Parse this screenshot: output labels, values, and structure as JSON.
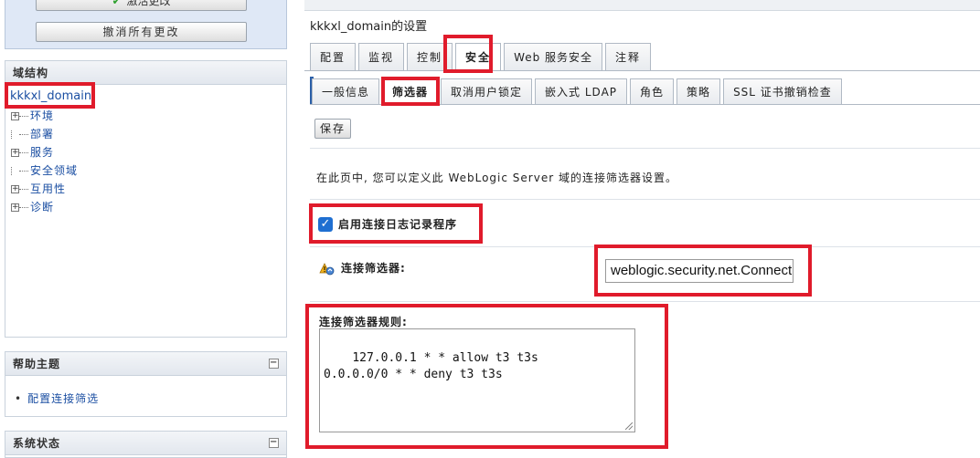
{
  "changes_panel": {
    "activate_label": "激活更改",
    "undo_label": "撤消所有更改"
  },
  "domain_panel": {
    "header": "域结构",
    "domain_name": "kkkxl_domain",
    "tree": [
      {
        "label": "环境",
        "expandable": true
      },
      {
        "label": "部署",
        "expandable": false
      },
      {
        "label": "服务",
        "expandable": true
      },
      {
        "label": "安全领域",
        "expandable": false
      },
      {
        "label": "互用性",
        "expandable": true
      },
      {
        "label": "诊断",
        "expandable": true
      }
    ]
  },
  "help_panel": {
    "header": "帮助主题",
    "items": [
      "配置连接筛选"
    ]
  },
  "status_panel": {
    "header": "系统状态"
  },
  "main": {
    "title_domain": "kkkxl_domain",
    "title_suffix": "的设置",
    "tabs": [
      "配置",
      "监视",
      "控制",
      "安全",
      "Web 服务安全",
      "注释"
    ],
    "active_tab": "安全",
    "subtabs": [
      "一般信息",
      "筛选器",
      "取消用户锁定",
      "嵌入式 LDAP",
      "角色",
      "策略",
      "SSL 证书撤销检查"
    ],
    "active_subtab": "筛选器",
    "save_label": "保存",
    "intro": "在此页中, 您可以定义此 WebLogic Server 域的连接筛选器设置。",
    "enable_logging_label": "启用连接日志记录程序",
    "enable_logging_checked": true,
    "filter_label": "连接筛选器:",
    "filter_value": "weblogic.security.net.ConnectionFilterImpl",
    "rules_label": "连接筛选器规则:",
    "rules_value": "127.0.0.1 * * allow t3 t3s\n0.0.0.0/0 * * deny t3 t3s"
  },
  "colors": {
    "highlight": "#e01b2b",
    "link": "#1a4ea2",
    "checkbox": "#1f6fd1"
  }
}
